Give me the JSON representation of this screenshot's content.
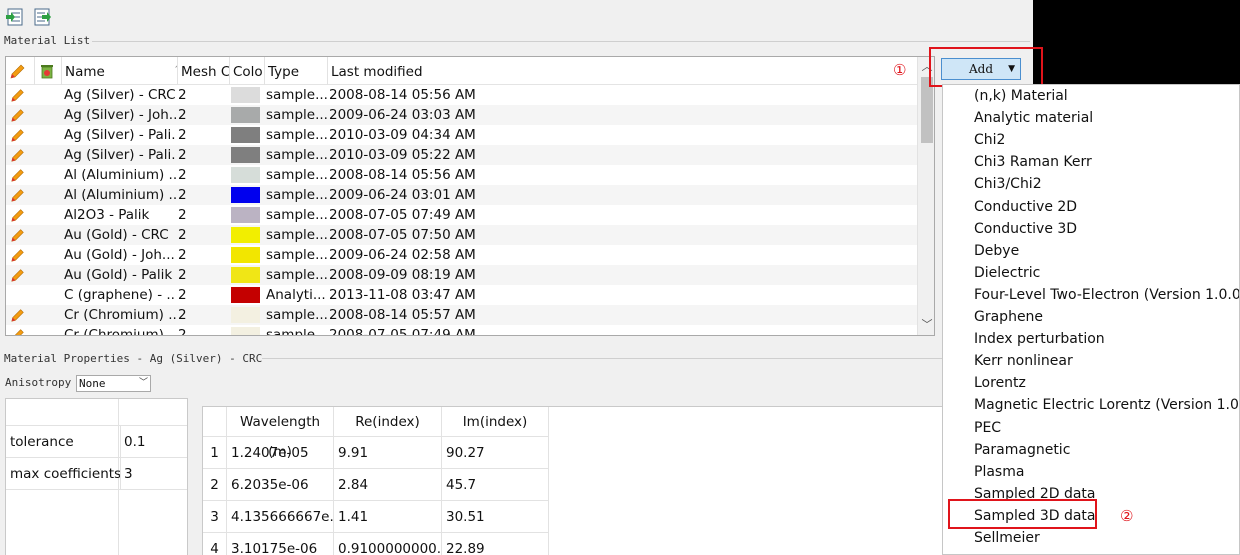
{
  "toolbar": {
    "icons": [
      "import-materials-icon",
      "export-materials-icon"
    ]
  },
  "material_list": {
    "label": "Material List",
    "columns": [
      "Name",
      "Mesh C",
      "Colo",
      "Type",
      "Last modified"
    ],
    "rows": [
      {
        "name": "Ag (Silver) - CRC",
        "mesh": "2",
        "color": "#dcdcdc",
        "type": "sample...",
        "modified": "2008-08-14 05:56 AM",
        "has_icon": true
      },
      {
        "name": "Ag (Silver) - Joh...",
        "mesh": "2",
        "color": "#a8aaaa",
        "type": "sample...",
        "modified": "2009-06-24 03:03 AM",
        "has_icon": true
      },
      {
        "name": "Ag (Silver) - Pali...",
        "mesh": "2",
        "color": "#7f7f7f",
        "type": "sample...",
        "modified": "2010-03-09 04:34 AM",
        "has_icon": true
      },
      {
        "name": "Ag (Silver) - Pali...",
        "mesh": "2",
        "color": "#7f7f7f",
        "type": "sample...",
        "modified": "2010-03-09 05:22 AM",
        "has_icon": true
      },
      {
        "name": "Al (Aluminium) ...",
        "mesh": "2",
        "color": "#d6ddd9",
        "type": "sample...",
        "modified": "2008-08-14 05:56 AM",
        "has_icon": true
      },
      {
        "name": "Al (Aluminium) ...",
        "mesh": "2",
        "color": "#0000ee",
        "type": "sample...",
        "modified": "2009-06-24 03:01 AM",
        "has_icon": true
      },
      {
        "name": "Al2O3 - Palik",
        "mesh": "2",
        "color": "#bbb3c3",
        "type": "sample...",
        "modified": "2008-07-05 07:49 AM",
        "has_icon": true
      },
      {
        "name": "Au (Gold) - CRC",
        "mesh": "2",
        "color": "#f2ee00",
        "type": "sample...",
        "modified": "2008-07-05 07:50 AM",
        "has_icon": true
      },
      {
        "name": "Au (Gold) - Joh...",
        "mesh": "2",
        "color": "#f2e600",
        "type": "sample...",
        "modified": "2009-06-24 02:58 AM",
        "has_icon": true
      },
      {
        "name": "Au (Gold) - Palik",
        "mesh": "2",
        "color": "#f0e616",
        "type": "sample...",
        "modified": "2008-09-09 08:19 AM",
        "has_icon": true
      },
      {
        "name": "C (graphene) - ...",
        "mesh": "2",
        "color": "#c40000",
        "type": "Analyti...",
        "modified": "2013-11-08 03:47 AM",
        "has_icon": false
      },
      {
        "name": "Cr (Chromium) ...",
        "mesh": "2",
        "color": "#f3f0e1",
        "type": "sample...",
        "modified": "2008-08-14 05:57 AM",
        "has_icon": true
      },
      {
        "name": "Cr (Chromium)",
        "mesh": "2",
        "color": "#f3f0e1",
        "type": "sample...",
        "modified": "2008-07-05 07:49 AM",
        "has_icon": true
      }
    ]
  },
  "add_button": {
    "label": "Add"
  },
  "annotations": {
    "one": "①",
    "two": "②"
  },
  "add_menu": {
    "items": [
      "(n,k) Material",
      "Analytic material",
      "Chi2",
      "Chi3 Raman Kerr",
      "Chi3/Chi2",
      "Conductive 2D",
      "Conductive 3D",
      "Debye",
      "Dielectric",
      "Four-Level Two-Electron (Version 1.0.0)",
      "Graphene",
      "Index perturbation",
      "Kerr nonlinear",
      "Lorentz",
      "Magnetic Electric Lorentz (Version 1.0.0)",
      "PEC",
      "Paramagnetic",
      "Plasma",
      "Sampled 2D data",
      "Sampled 3D data",
      "Sellmeier"
    ],
    "highlighted": "Sampled 3D data"
  },
  "properties": {
    "label": "Material Properties - Ag (Silver) - CRC",
    "anisotropy_label": "Anisotropy",
    "anisotropy_value": "None",
    "params": [
      {
        "label": "tolerance",
        "value": "0.1"
      },
      {
        "label": "max coefficients",
        "value": "3"
      }
    ]
  },
  "sampled_data": {
    "columns": [
      "Wavelength (m)",
      "Re(index)",
      "Im(index)"
    ],
    "rows": [
      {
        "idx": "1",
        "wl": "1.2407e-05",
        "re": "9.91",
        "im": "90.27"
      },
      {
        "idx": "2",
        "wl": "6.2035e-06",
        "re": "2.84",
        "im": "45.7"
      },
      {
        "idx": "3",
        "wl": "4.135666667e...",
        "re": "1.41",
        "im": "30.51"
      },
      {
        "idx": "4",
        "wl": "3.10175e-06",
        "re": "0.9100000000...",
        "im": "22.89"
      }
    ]
  }
}
